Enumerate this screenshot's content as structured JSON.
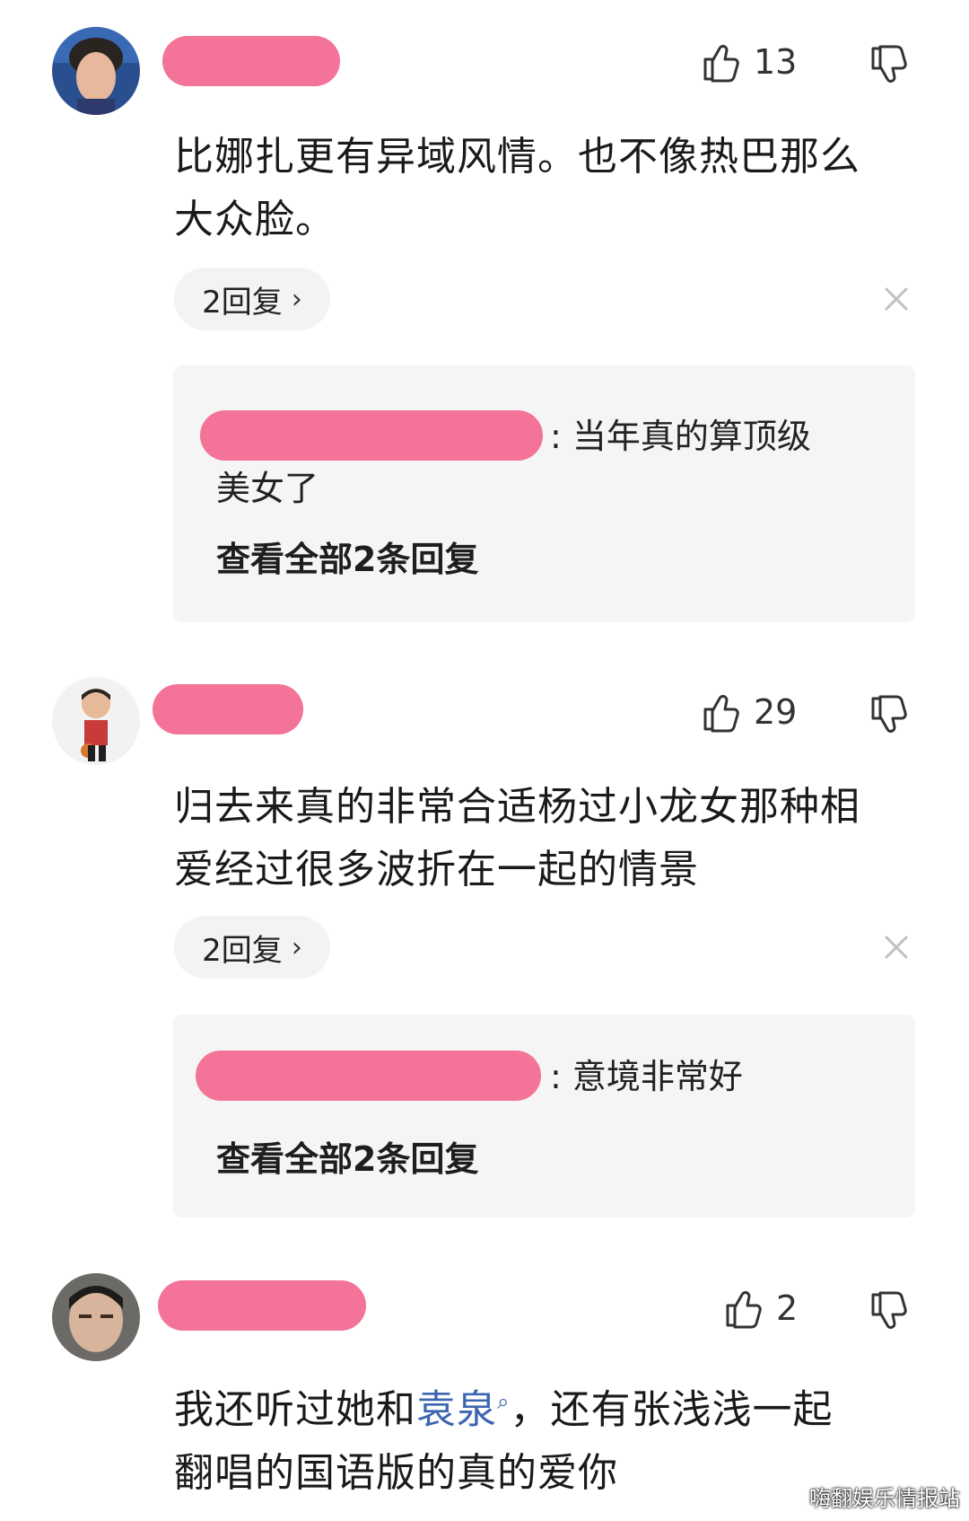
{
  "comments": [
    {
      "likes": "13",
      "text_line1": "比娜扎更有异域风情。也不像热巴那么",
      "text_line2": "大众脸。",
      "reply_count_label": "2回复",
      "reply_preview_suffix": ": 当年真的算顶级",
      "reply_preview_line2": "美女了",
      "view_all_label": "查看全部2条回复"
    },
    {
      "likes": "29",
      "text_line1": "归去来真的非常合适杨过小龙女那种相",
      "text_line2": "爱经过很多波折在一起的情景",
      "reply_count_label": "2回复",
      "reply_preview_suffix": ": 意境非常好",
      "view_all_label": "查看全部2条回复"
    },
    {
      "likes": "2",
      "text_line1_pre": "我还听过她和",
      "text_line1_link": "袁泉",
      "text_line1_post": "，还有张浅浅一起",
      "text_line2": "翻唱的国语版的真的爱你"
    }
  ],
  "watermark": "嗨翻娱乐情报站",
  "colors": {
    "name_mask": "#f47398",
    "reply_box_bg": "#f5f5f5",
    "pill_bg": "#f3f3f3",
    "link": "#3d66b0"
  },
  "icons": [
    "thumbs-up-icon",
    "thumbs-down-icon",
    "close-icon",
    "chevron-right-icon",
    "search-icon"
  ]
}
